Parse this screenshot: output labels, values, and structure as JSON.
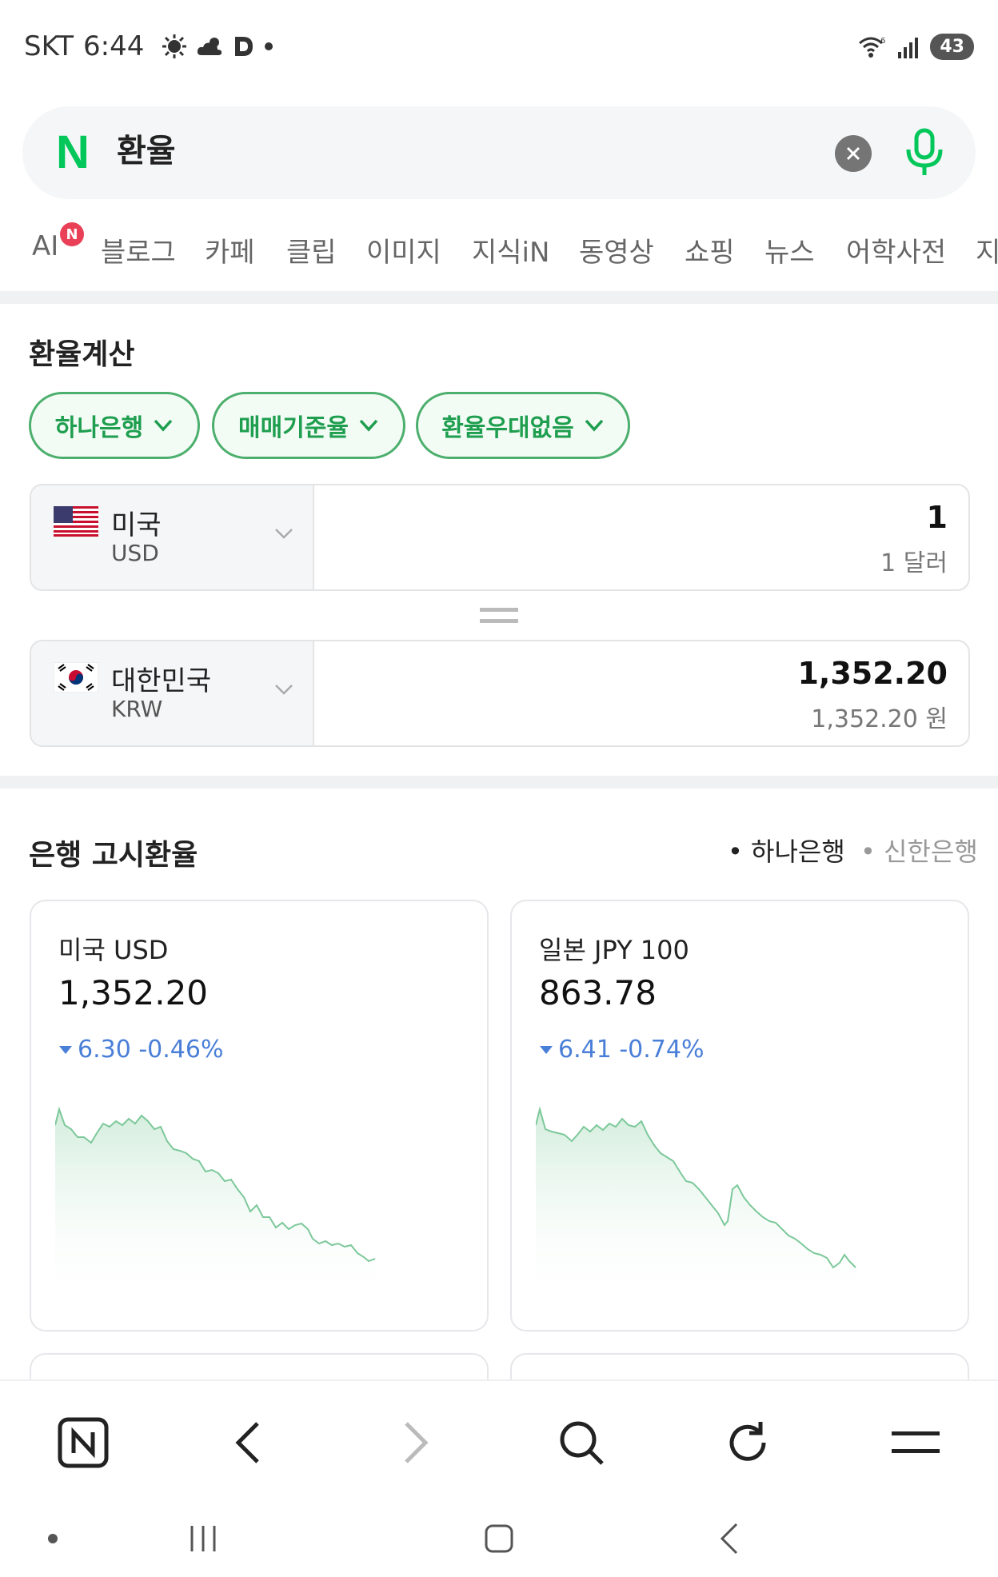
{
  "status_bar": {
    "carrier": "SKT",
    "time": "6:44",
    "icons": [
      "brightness-icon",
      "cloud-icon",
      "d-app-icon",
      "dot-icon",
      "wifi-icon",
      "signal-icon"
    ],
    "battery": "43"
  },
  "search": {
    "logo": "N",
    "query": "환율",
    "clear_icon": "close-icon",
    "mic_icon": "microphone-icon"
  },
  "tabs": {
    "ai_badge": "N",
    "items": [
      "AI",
      "블로그",
      "카페",
      "클립",
      "이미지",
      "지식iN",
      "동영상",
      "쇼핑",
      "뉴스",
      "어학사전",
      "지"
    ]
  },
  "calculator": {
    "title": "환율계산",
    "chips": [
      "하나은행",
      "매매기준율",
      "환율우대없음"
    ],
    "from": {
      "country": "미국",
      "code": "USD",
      "amount": "1",
      "amount_text": "1 달러"
    },
    "to": {
      "country": "대한민국",
      "code": "KRW",
      "amount": "1,352.20",
      "amount_text": "1,352.20 원"
    }
  },
  "bank_rates": {
    "title": "은행 고시환율",
    "options": [
      "하나은행",
      "신한은행"
    ],
    "cards": [
      {
        "title": "미국 USD",
        "value": "1,352.20",
        "change": "6.30 -0.46%"
      },
      {
        "title": "일본 JPY 100",
        "value": "863.78",
        "change": "6.41 -0.74%"
      }
    ]
  },
  "colors": {
    "brand_green": "#03c75a",
    "chip_green": "#1e9e4e",
    "down_blue": "#4a7fd8",
    "chart_line": "#7cc89a",
    "badge_red": "#e94057"
  },
  "bottom_nav": [
    "naver-home-icon",
    "back-icon",
    "forward-icon",
    "search-icon",
    "refresh-icon",
    "menu-icon"
  ],
  "system_nav": [
    "dot-icon",
    "recents-icon",
    "home-icon",
    "system-back-icon"
  ]
}
